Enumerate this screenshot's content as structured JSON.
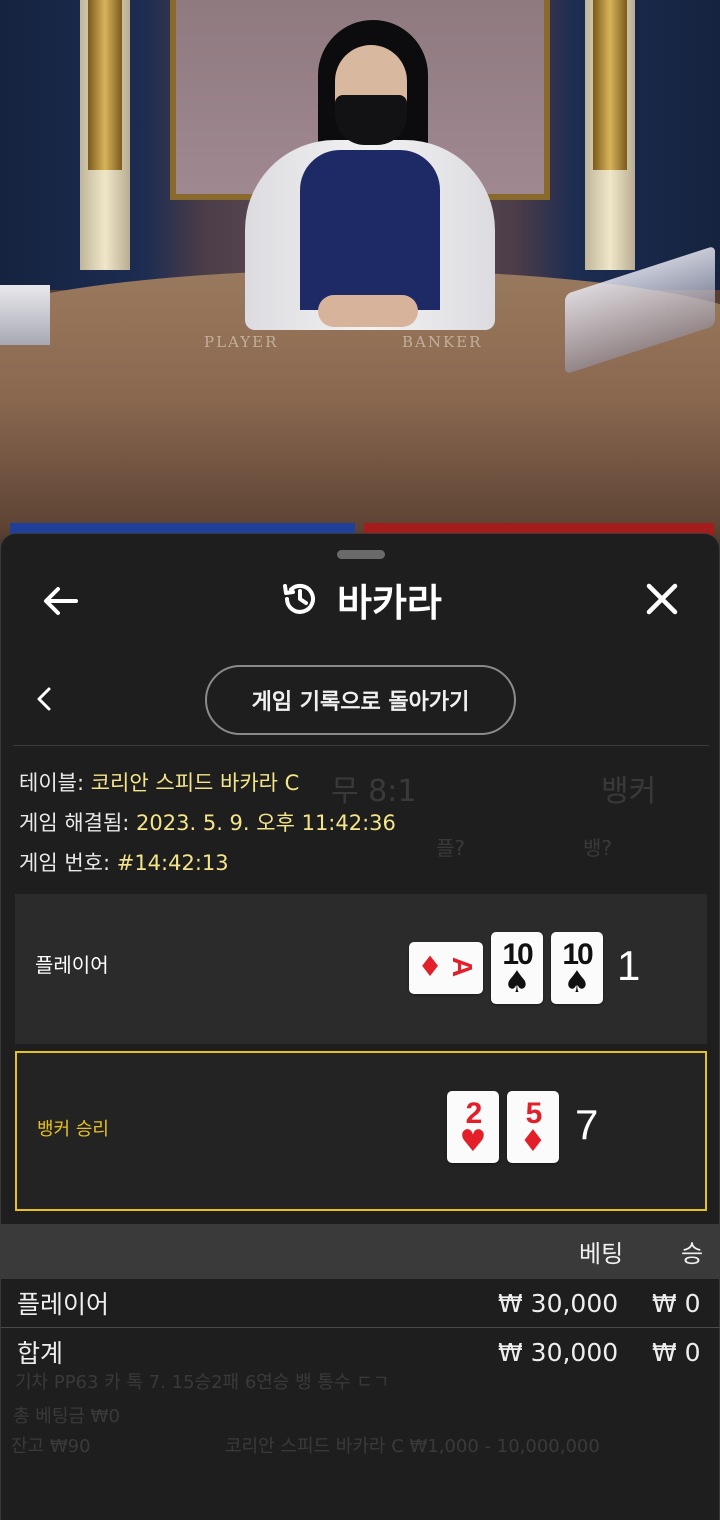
{
  "background_table": {
    "player_label": "PLAYER",
    "banker_label": "BANKER"
  },
  "sheet": {
    "title": "바카라",
    "back_to_history_label": "게임 기록으로 돌아가기"
  },
  "ghost": {
    "tie_payout": "무 8:1",
    "banker_label": "뱅커",
    "player_q": "플?",
    "banker_q": "뱅?",
    "footer_stats": "기차  PP63 카 톡  7. 15승2패 6연승 뱅 통수 ㄷㄱ",
    "total_bet": "총 베팅금 ₩0",
    "balance": "잔고 ₩90",
    "table_limits": "코리안 스피드 바카라 C ₩1,000 - 10,000,000"
  },
  "game_info": {
    "table_label": "테이블:",
    "table_value": "코리안 스피드 바카라 C",
    "resolved_label": "게임 해결됨:",
    "resolved_value": "2023. 5. 9. 오후 11:42:36",
    "number_label": "게임 번호:",
    "number_value": "#14:42:13"
  },
  "player_hand": {
    "label": "플레이어",
    "score": "1",
    "cards": [
      {
        "rank": "A",
        "suit": "♦",
        "color": "red",
        "rotated": true
      },
      {
        "rank": "10",
        "suit": "♠",
        "color": "black",
        "rotated": false
      },
      {
        "rank": "10",
        "suit": "♠",
        "color": "black",
        "rotated": false
      }
    ]
  },
  "banker_hand": {
    "label": "뱅커 승리",
    "score": "7",
    "cards": [
      {
        "rank": "2",
        "suit": "♥",
        "color": "red",
        "rotated": false
      },
      {
        "rank": "5",
        "suit": "♦",
        "color": "red",
        "rotated": false
      }
    ]
  },
  "bets_table": {
    "headers": {
      "bet": "베팅",
      "win": "승"
    },
    "rows": [
      {
        "name": "플레이어",
        "bet": "₩ 30,000",
        "win": "₩ 0"
      }
    ],
    "total": {
      "name": "합계",
      "bet": "₩ 30,000",
      "win": "₩ 0"
    }
  },
  "colors": {
    "accent_yellow": "#e6c21f",
    "value_yellow": "#f4e48a",
    "card_red": "#e3202a",
    "sheet_bg": "#1e1e1e"
  },
  "icons": {
    "back": "arrow-left-icon",
    "history": "history-clock-icon",
    "close": "close-icon",
    "chevron": "chevron-left-icon"
  }
}
